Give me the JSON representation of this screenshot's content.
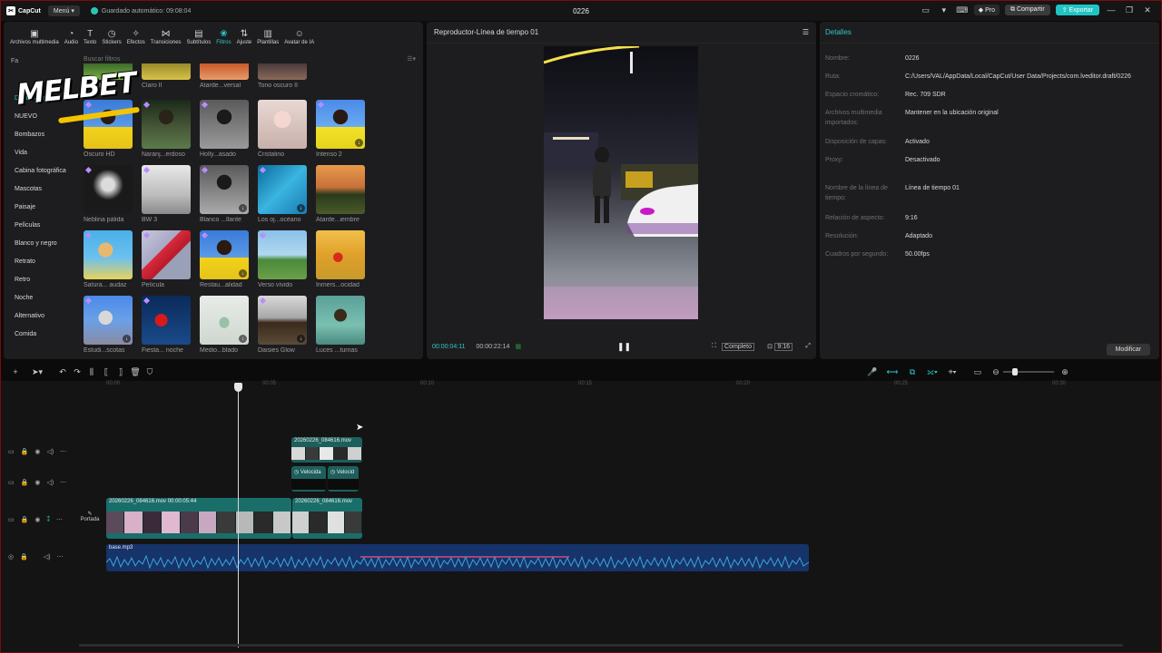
{
  "titlebar": {
    "app_name": "CapCut",
    "menu_label": "Menú",
    "autosave_text": "Guardado automático: 09:08:04",
    "project_title": "0226",
    "pro_label": "Pro",
    "share_label": "Compartir",
    "export_label": "Exportar",
    "accent_color": "#21c4c4"
  },
  "toolbar": {
    "items": [
      {
        "label": "Archivos multimedia",
        "icon": "media-icon"
      },
      {
        "label": "Audio",
        "icon": "audio-icon"
      },
      {
        "label": "Texto",
        "icon": "text-icon"
      },
      {
        "label": "Stickers",
        "icon": "sticker-icon"
      },
      {
        "label": "Efectos",
        "icon": "effects-icon"
      },
      {
        "label": "Transiciones",
        "icon": "transition-icon"
      },
      {
        "label": "Subtítulos",
        "icon": "subtitles-icon"
      },
      {
        "label": "Filtros",
        "icon": "filters-icon"
      },
      {
        "label": "Ajuste",
        "icon": "adjust-icon"
      },
      {
        "label": "Plantillas",
        "icon": "templates-icon"
      },
      {
        "label": "Avatar de IA",
        "icon": "avatar-icon"
      }
    ],
    "active": "Filtros"
  },
  "library": {
    "fav_label": "Fa",
    "search_placeholder": "Buscar filtros",
    "watermark": "MELBET",
    "categories": [
      "Destacado",
      "NUEVO",
      "Bombazos",
      "Vida",
      "Cabina fotográfica",
      "Mascotas",
      "Paisaje",
      "Películas",
      "Blanco y negro",
      "Retrato",
      "Retro",
      "Noche",
      "Alternativo",
      "Comida"
    ],
    "active_category": "Destacado",
    "filters": [
      "Lima fresca",
      "Claro II",
      "Atarde...versal",
      "Tono oscuro II",
      "",
      "Oscuro HD",
      "Naranj...erdoso",
      "Holly...asado",
      "Cristalino",
      "Intenso 2",
      "Neblina pálida",
      "BW 3",
      "Blanco ...llante",
      "Los oj...océano",
      "Atarde...iembre",
      "Satura... audaz",
      "Película",
      "Restau...alidad",
      "Verso vívido",
      "Inmers...ocidad",
      "Estudi...scotas",
      "Fiesta... noche",
      "Medio...blado",
      "Daisies Glow",
      "Luces ...turnas"
    ]
  },
  "player": {
    "title": "Reproductor-Línea de tiempo 01",
    "current_time": "00:00:04:11",
    "total_time": "00:00:22:14",
    "quality_label": "Completo",
    "ratio_label": "9:16"
  },
  "details": {
    "title": "Detalles",
    "rows": [
      {
        "key": "Nombre:",
        "value": "0226"
      },
      {
        "key": "Ruta:",
        "value": "C:/Users/VAL/AppData/Local/CapCut/User Data/Projects/com.lveditor.draft/0226"
      },
      {
        "key": "Espacio cromático:",
        "value": "Rec. 709 SDR"
      },
      {
        "key": "Archivos multimedia importados:",
        "value": "Mantener en la ubicación original"
      },
      {
        "key": "Disposición de capas:",
        "value": "Activado"
      },
      {
        "key": "Proxy:",
        "value": "Desactivado"
      },
      {
        "key": "Nombre de la línea de tiempo:",
        "value": "Línea de tiempo 01"
      },
      {
        "key": "Relación de aspecto:",
        "value": "9:16"
      },
      {
        "key": "Resolución:",
        "value": "Adaptado"
      },
      {
        "key": "Cuadros por segundo:",
        "value": "50.00fps"
      }
    ],
    "modify_label": "Modificar"
  },
  "timeline": {
    "ruler": [
      "00:00",
      "00:05",
      "00:10",
      "00:15",
      "00:20",
      "00:25",
      "00:30"
    ],
    "cover_label": "Portada",
    "overlay_clip": "20260226_084616.mov",
    "speed_label_1": "Velocida",
    "speed_label_2": "Velocid",
    "main_clip_1": "20260226_084616.mov  00:00:05:44",
    "main_clip_2": "20260226_084616.mov",
    "audio_clip": "base.mp3"
  }
}
